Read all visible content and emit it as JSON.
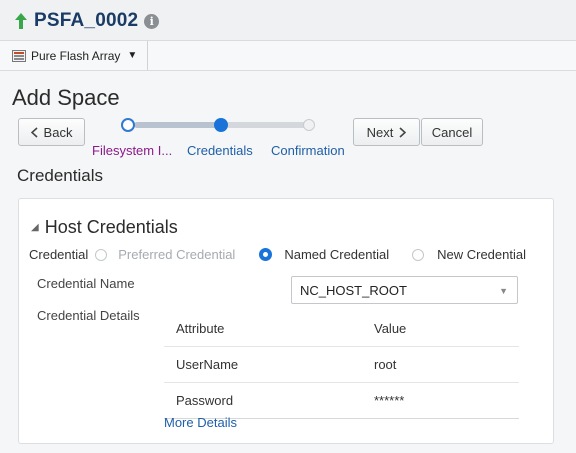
{
  "header": {
    "title": "PSFA_0002",
    "info_icon": "i",
    "status_color": "#3aa64a",
    "title_color": "#1a3b66"
  },
  "target_menu": {
    "label": "Pure Flash Array",
    "icon": "storage-array-icon"
  },
  "page": {
    "title": "Add Space"
  },
  "train": {
    "back_label": "Back",
    "next_label": "Next",
    "cancel_label": "Cancel",
    "steps": [
      {
        "label": "Filesystem I...",
        "state": "visited",
        "color": "#8b1a8b"
      },
      {
        "label": "Credentials",
        "state": "current",
        "color": "#1f5fa8"
      },
      {
        "label": "Confirmation",
        "state": "future",
        "color": "#1f5fa8"
      }
    ]
  },
  "section": {
    "title": "Credentials"
  },
  "host_credentials": {
    "title": "Host Credentials",
    "credential_label": "Credential",
    "options": [
      {
        "label": "Preferred Credential",
        "selected": false,
        "disabled": true
      },
      {
        "label": "Named Credential",
        "selected": true,
        "disabled": false
      },
      {
        "label": "New Credential",
        "selected": false,
        "disabled": false
      }
    ],
    "credential_name_label": "Credential Name",
    "credential_name_value": "NC_HOST_ROOT",
    "credential_details_label": "Credential Details",
    "details_table": {
      "columns": [
        "Attribute",
        "Value"
      ],
      "rows": [
        [
          "UserName",
          "root"
        ],
        [
          "Password",
          "******"
        ]
      ]
    },
    "more_details_label": "More Details"
  }
}
